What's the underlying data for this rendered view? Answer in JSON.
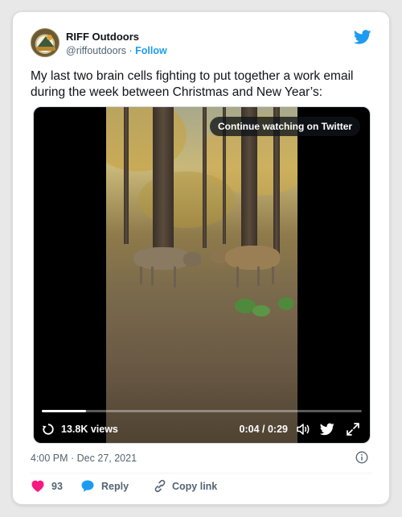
{
  "author": {
    "name": "RIFF Outdoors",
    "handle": "@riffoutdoors",
    "separator": "·",
    "follow_label": "Follow"
  },
  "tweet": {
    "text": "My last two brain cells fighting to put together a work email during the week between Christmas and New Year’s:",
    "timestamp": "4:00 PM · Dec 27, 2021"
  },
  "video": {
    "overlay_label": "Continue watching on Twitter",
    "views": "13.8K views",
    "time": "0:04 / 0:29",
    "progress_fraction": 0.138
  },
  "actions": {
    "likes_count": "93",
    "reply_label": "Reply",
    "copy_link_label": "Copy link"
  },
  "colors": {
    "brand_blue": "#1d9bf0",
    "like_red": "#f91880",
    "text_secondary": "#536471"
  },
  "icons": [
    "twitter-bird-icon",
    "replay-icon",
    "volume-icon",
    "expand-icon",
    "info-icon",
    "heart-icon",
    "reply-bubble-icon",
    "link-icon"
  ]
}
